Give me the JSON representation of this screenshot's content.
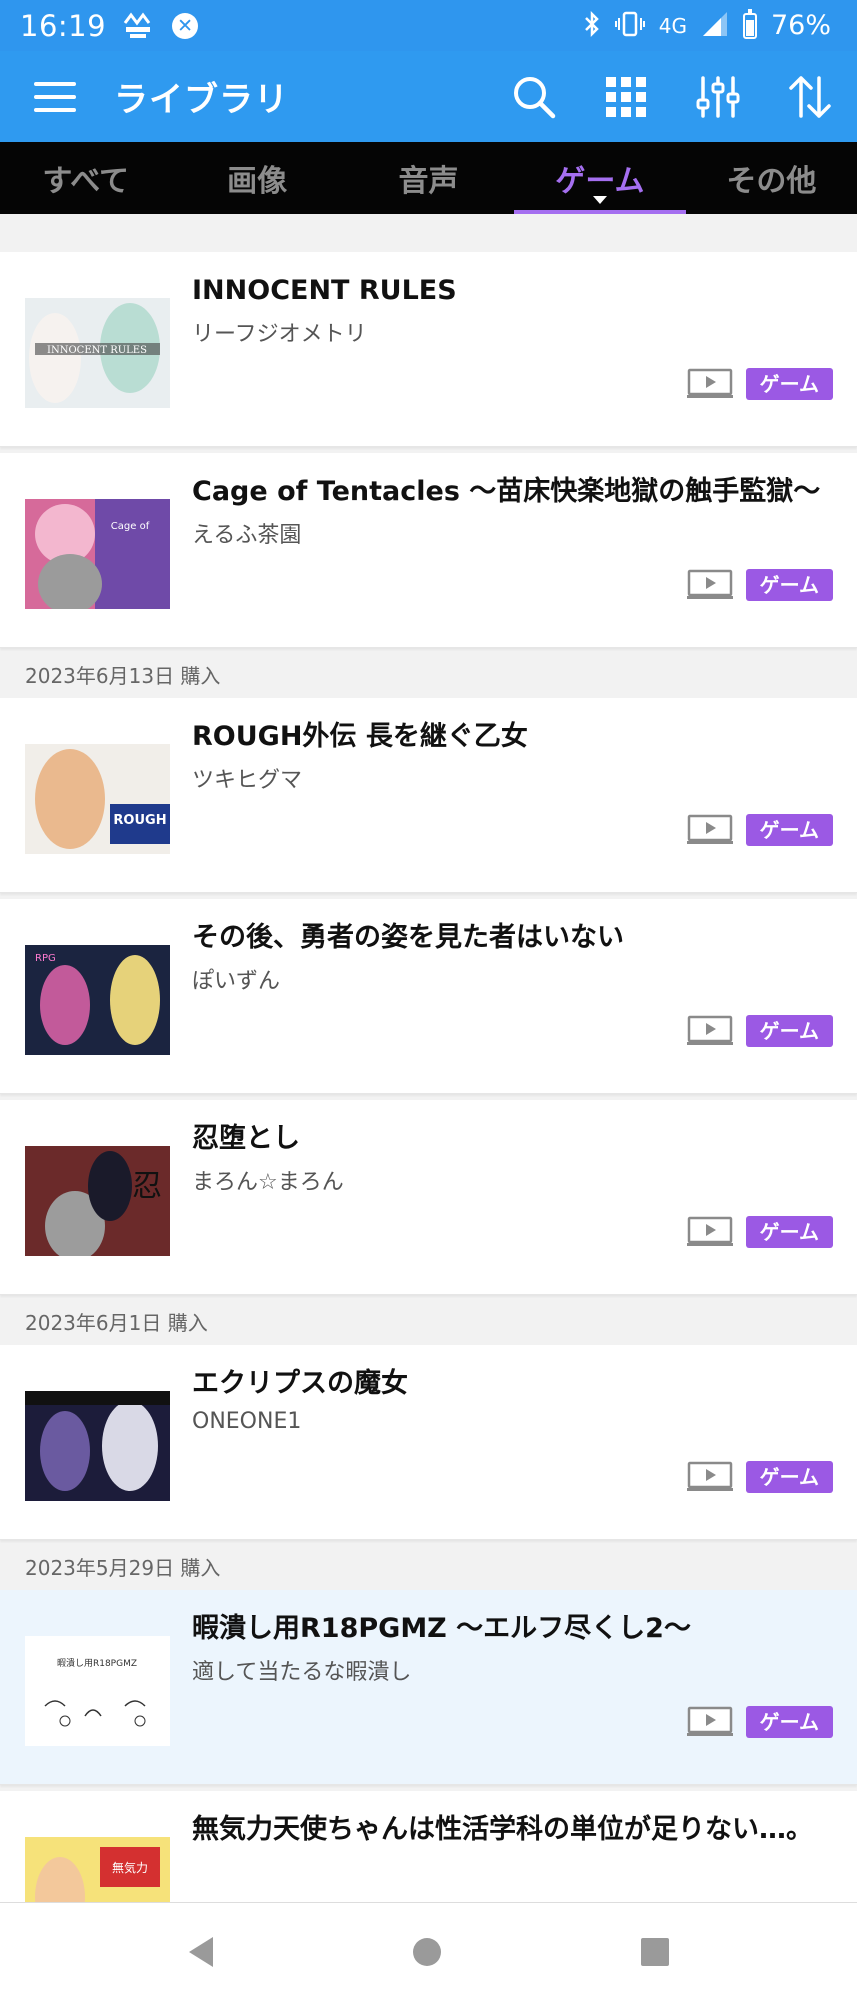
{
  "status_bar": {
    "time": "16:19",
    "network": "4G",
    "battery": "76%",
    "battery_level": 0.76
  },
  "app_bar": {
    "title": "ライブラリ",
    "bg_color": "#2f9af0"
  },
  "tabs": [
    {
      "label": "すべて",
      "active": false
    },
    {
      "label": "画像",
      "active": false
    },
    {
      "label": "音声",
      "active": false
    },
    {
      "label": "ゲーム",
      "active": true
    },
    {
      "label": "その他",
      "active": false
    }
  ],
  "accent_color": "#a56ff0",
  "items": [
    {
      "title": "INNOCENT RULES",
      "circle": "リーフジオメトリ",
      "tag": "ゲーム",
      "thumb_icon": "innocent-rules-cover"
    },
    {
      "title": "Cage of Tentacles 〜苗床快楽地獄の触手監獄〜",
      "circle": "えるふ茶園",
      "tag": "ゲーム",
      "thumb_icon": "cage-of-tentacles-cover"
    },
    {
      "title": "ROUGH外伝 長を継ぐ乙女",
      "circle": "ツキヒグマ",
      "tag": "ゲーム",
      "thumb_icon": "rough-gaiden-cover"
    },
    {
      "title": "その後、勇者の姿を見た者はいない",
      "circle": "ぽいずん",
      "tag": "ゲーム",
      "thumb_icon": "yuusha-cover"
    },
    {
      "title": "忍堕とし",
      "circle": "まろん☆まろん",
      "tag": "ゲーム",
      "thumb_icon": "shinobi-cover"
    },
    {
      "title": "エクリプスの魔女",
      "circle": "ONEONE1",
      "tag": "ゲーム",
      "thumb_icon": "eclipse-witch-cover"
    },
    {
      "title": "暇潰し用R18PGMZ 〜エルフ尽くし2〜",
      "circle": "適して当たるな暇潰し",
      "tag": "ゲーム",
      "thumb_icon": "himatsubushi-cover"
    },
    {
      "title": "無気力天使ちゃんは性活学科の単位が足りない…。",
      "circle": "",
      "tag": "",
      "thumb_icon": "angel-cover"
    }
  ],
  "date_headers": [
    "2023年6月13日  購入",
    "2023年6月1日  購入",
    "2023年5月29日  購入"
  ]
}
